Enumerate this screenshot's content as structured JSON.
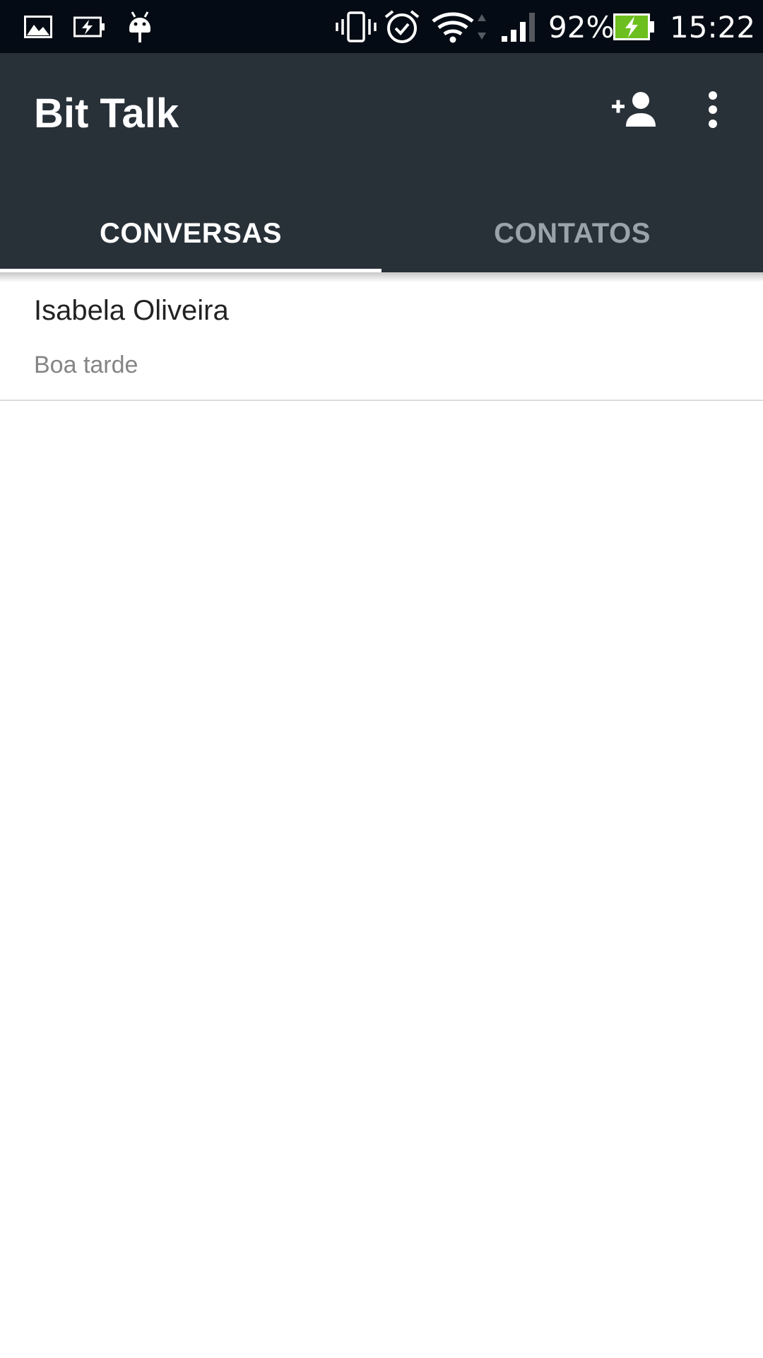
{
  "status_bar": {
    "battery_percent": "92%",
    "time": "15:22",
    "icons": [
      "image-notification-icon",
      "battery-charging-notification-icon",
      "android-debug-icon",
      "vibrate-icon",
      "alarm-icon",
      "wifi-icon",
      "cellular-signal-icon",
      "battery-charging-icon"
    ],
    "battery_color": "#6cbf1e"
  },
  "app_bar": {
    "title": "Bit Talk",
    "background_color": "#283038",
    "actions": [
      "add-contact-icon",
      "more-options-icon"
    ]
  },
  "tabs": [
    {
      "label": "CONVERSAS",
      "active": true
    },
    {
      "label": "CONTATOS",
      "active": false
    }
  ],
  "conversations": [
    {
      "name": "Isabela Oliveira",
      "last_message": "Boa tarde"
    }
  ]
}
